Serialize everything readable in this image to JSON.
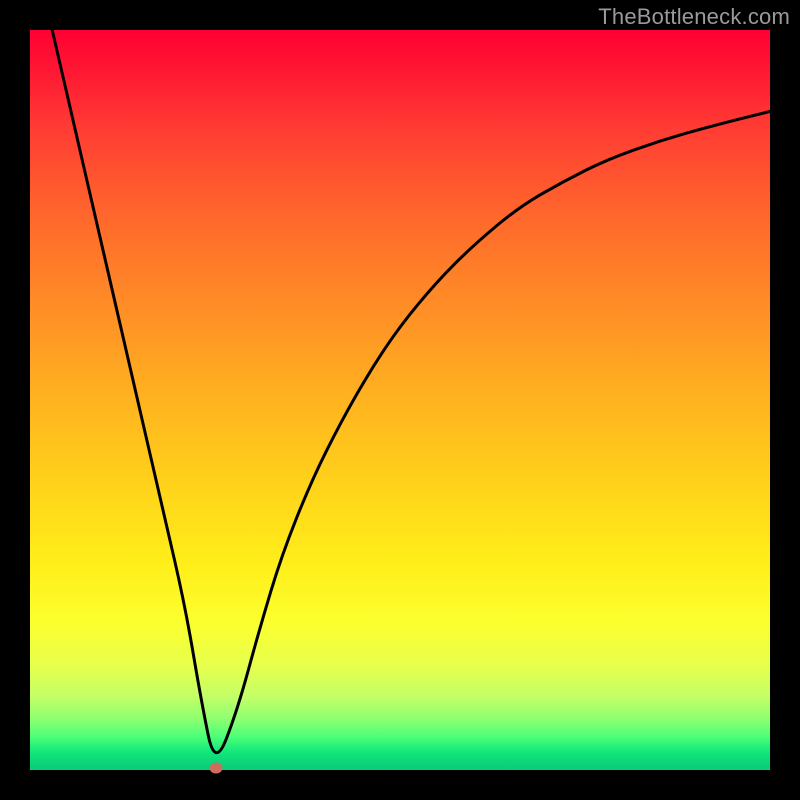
{
  "watermark": "TheBottleneck.com",
  "chart_data": {
    "type": "line",
    "title": "",
    "xlabel": "",
    "ylabel": "",
    "xlim": [
      0,
      100
    ],
    "ylim": [
      0,
      100
    ],
    "grid": false,
    "series": [
      {
        "name": "curve",
        "x": [
          3,
          6,
          9,
          12,
          15,
          18,
          21,
          23.2,
          25,
          28,
          31,
          34,
          38,
          42,
          46,
          50,
          55,
          60,
          66,
          72,
          78,
          85,
          92,
          100
        ],
        "y": [
          100,
          87,
          74,
          61,
          48,
          35,
          22,
          9,
          0.3,
          8,
          19,
          29,
          39,
          47,
          54,
          60,
          66,
          71,
          76,
          79.5,
          82.5,
          85,
          87,
          89
        ]
      }
    ],
    "marker": {
      "x": 25.2,
      "y": 0.3
    },
    "background_gradient": {
      "top": "#ff0033",
      "mid1": "#ff8f26",
      "mid2": "#ffee1a",
      "bottom": "#0acc79"
    }
  }
}
